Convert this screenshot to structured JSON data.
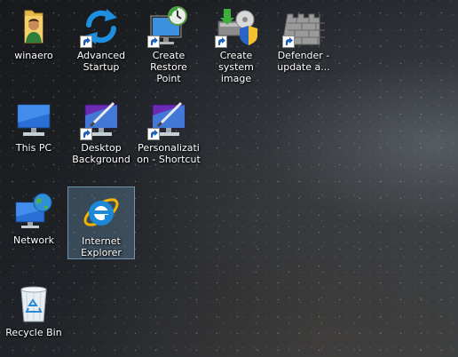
{
  "desktop": {
    "icons": [
      {
        "label": "winaero",
        "icon": "folder-user-icon",
        "shortcut": false
      },
      {
        "label": "Advanced Startup",
        "icon": "refresh-icon",
        "shortcut": true
      },
      {
        "label": "Create Restore Point",
        "icon": "restore-point-icon",
        "shortcut": true
      },
      {
        "label": "Create system image",
        "icon": "backup-shield-icon",
        "shortcut": true
      },
      {
        "label": "Defender - update a...",
        "icon": "castle-wall-icon",
        "shortcut": true
      },
      {
        "label": "This PC",
        "icon": "monitor-icon",
        "shortcut": false
      },
      {
        "label": "Desktop Background",
        "icon": "paint-monitor-icon",
        "shortcut": true
      },
      {
        "label": "Personalization - Shortcut",
        "icon": "paint-monitor-icon",
        "shortcut": true
      },
      {
        "label": "Network",
        "icon": "network-globe-icon",
        "shortcut": false
      },
      {
        "label": "Internet Explorer",
        "icon": "internet-explorer-icon",
        "shortcut": false,
        "selected": true
      },
      {
        "label": "Recycle Bin",
        "icon": "recycle-bin-icon",
        "shortcut": false
      }
    ]
  }
}
